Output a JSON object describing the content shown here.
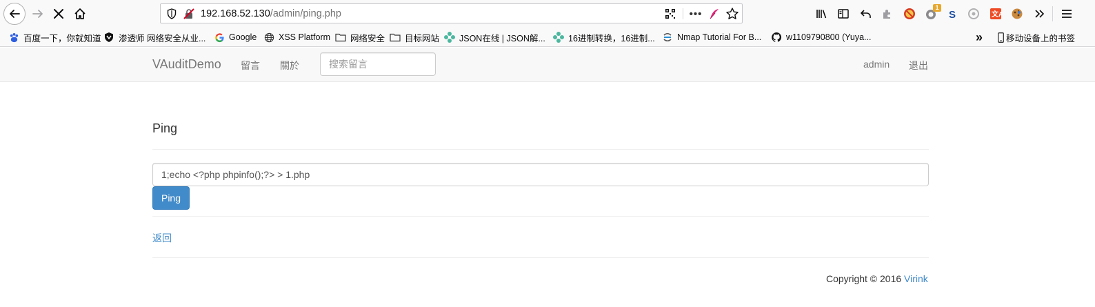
{
  "browser": {
    "url_host": "192.168.52.130",
    "url_path": "/admin/ping.php",
    "badge_count": "1",
    "more_dots": "•••"
  },
  "bookmarks": [
    {
      "label": "百度一下，你就知道",
      "icon": "baidu-paw-icon"
    },
    {
      "label": "渗透师 网络安全从业...",
      "icon": "shield-logo-icon"
    },
    {
      "label": "Google",
      "icon": "google-g-icon"
    },
    {
      "label": "XSS Platform",
      "icon": "globe-icon"
    },
    {
      "label": "网络安全",
      "icon": "folder-icon"
    },
    {
      "label": "目标网站",
      "icon": "folder-icon"
    },
    {
      "label": "JSON在线 | JSON解...",
      "icon": "gear-flower-icon"
    },
    {
      "label": "16进制转换，16进制...",
      "icon": "gear-flower-icon"
    },
    {
      "label": "Nmap Tutorial For B...",
      "icon": "nmap-icon"
    },
    {
      "label": "w1109790800 (Yuya...",
      "icon": "github-icon"
    }
  ],
  "bookmarks_overflow": "»",
  "mobile_bookmarks": "移动设备上的书签",
  "site": {
    "brand": "VAuditDemo",
    "nav_left": [
      "留言",
      "關於"
    ],
    "search_placeholder": "搜索留言",
    "nav_right": [
      "admin",
      "退出"
    ]
  },
  "page": {
    "heading": "Ping",
    "command_value": "1;echo <?php phpinfo();?> > 1.php",
    "ping_button": "Ping",
    "back_link": "返回",
    "copyright_text": "Copyright © 2016 ",
    "copyright_link": "Virink"
  },
  "colors": {
    "primary": "#428bca",
    "navbar_bg": "#f8f8f8",
    "toolbar_bg": "#f9f9fa"
  }
}
